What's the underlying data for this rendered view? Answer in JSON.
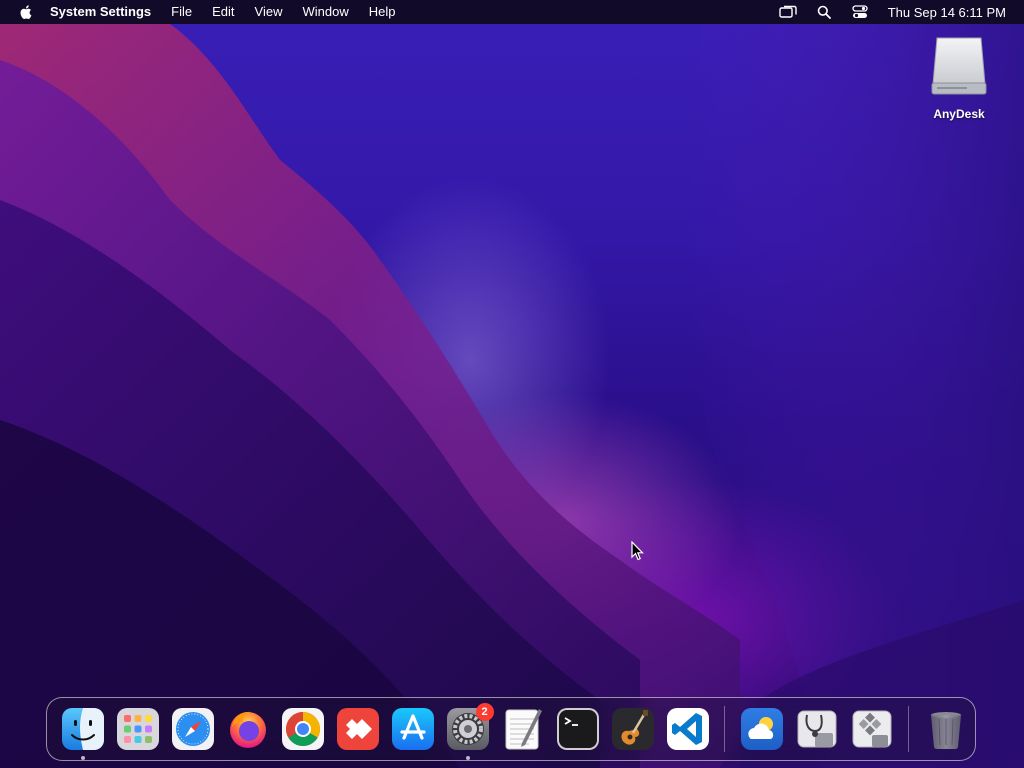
{
  "menubar": {
    "app_name": "System Settings",
    "menus": [
      "File",
      "Edit",
      "View",
      "Window",
      "Help"
    ],
    "clock": "Thu Sep 14  6:11 PM"
  },
  "desktop": {
    "icons": [
      {
        "label": "AnyDesk",
        "icon": "hard-drive-icon"
      }
    ]
  },
  "dock": {
    "apps": [
      {
        "name": "finder",
        "icon": "finder-icon",
        "running": true
      },
      {
        "name": "launchpad",
        "icon": "launchpad-icon",
        "running": false
      },
      {
        "name": "safari",
        "icon": "safari-icon",
        "running": false
      },
      {
        "name": "firefox",
        "icon": "firefox-icon",
        "running": false
      },
      {
        "name": "chrome",
        "icon": "chrome-icon",
        "running": false
      },
      {
        "name": "anydesk",
        "icon": "anydesk-icon",
        "running": false
      },
      {
        "name": "app-store",
        "icon": "app-store-icon",
        "running": false
      },
      {
        "name": "system-settings",
        "icon": "gear-icon",
        "running": true,
        "badge": "2"
      },
      {
        "name": "textedit",
        "icon": "textedit-icon",
        "running": false
      },
      {
        "name": "terminal",
        "icon": "terminal-icon",
        "running": false
      },
      {
        "name": "garageband",
        "icon": "guitar-icon",
        "running": false
      },
      {
        "name": "vscode",
        "icon": "vscode-icon",
        "running": false
      },
      {
        "name": "weather",
        "icon": "weather-icon",
        "running": false
      },
      {
        "name": "disk-utility",
        "icon": "disk-utility-icon",
        "running": false
      },
      {
        "name": "boot-camp-assistant",
        "icon": "boot-camp-icon",
        "running": false
      },
      {
        "name": "trash",
        "icon": "trash-icon",
        "running": false
      }
    ]
  },
  "colors": {
    "menubar_bg": "#0e0a1c",
    "badge": "#ff3b30",
    "wallpaper_base": "#2a0f8a"
  }
}
